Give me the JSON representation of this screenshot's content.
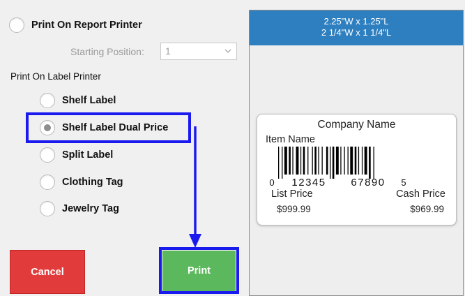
{
  "options": {
    "report_printer": "Print On Report Printer",
    "starting_position_label": "Starting Position:",
    "starting_position_value": "1",
    "label_printer_section": "Print On Label Printer",
    "shelf_label": "Shelf Label",
    "shelf_label_dual": "Shelf Label Dual Price",
    "split_label": "Split Label",
    "clothing_tag": "Clothing Tag",
    "jewelry_tag": "Jewelry Tag",
    "selected": "Shelf Label Dual Price"
  },
  "buttons": {
    "cancel": "Cancel",
    "print": "Print"
  },
  "preview": {
    "size_decimal": "2.25\"W x 1.25\"L",
    "size_fraction": "2 1/4\"W x 1 1/4\"L",
    "company": "Company Name",
    "item_name": "Item Name",
    "barcode_first": "0",
    "barcode_left": "12345",
    "barcode_right": "67890",
    "barcode_last": "5",
    "list_price_label": "List Price",
    "cash_price_label": "Cash Price",
    "list_price": "$999.99",
    "cash_price": "$969.99"
  },
  "colors": {
    "header_blue": "#2e7fbf",
    "cancel_red": "#e23b3b",
    "print_green": "#5cb85c",
    "highlight_blue": "#1a1aee"
  },
  "icons": {
    "dropdown": "chevron-down-icon",
    "annotation_arrow": "arrow-down-icon"
  }
}
